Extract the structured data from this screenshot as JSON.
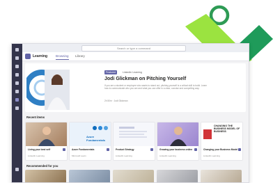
{
  "window": {
    "search_placeholder": "Search or type a command"
  },
  "app": {
    "name": "Learning",
    "tabs": [
      "Browsing",
      "Library"
    ]
  },
  "hero": {
    "badge": "Featured",
    "badge_sub": "LinkedIn Learning",
    "title": "Jodi Glickman on Pitching Yourself",
    "description": "If you are a student or employee who wants to stand out, pitching yourself is a critical skill to build. Learn how to communicate who you are and what you can offer in a clear, concise and compelling way.",
    "meta": "2h 50m  ·  Jodi Glickman"
  },
  "sections": {
    "recent": "Recent items",
    "recommended": "Recommended for you"
  },
  "cards": [
    {
      "title": "Living your best self",
      "meta": "LinkedIn Learning"
    },
    {
      "title": "Azure Fundamentals",
      "meta": "Microsoft Learn"
    },
    {
      "title": "Product Strategy",
      "meta": "LinkedIn Learning"
    },
    {
      "title": "Growing your business online",
      "meta": "LinkedIn Learning"
    },
    {
      "title": "Changing your Business Model",
      "meta": "LinkedIn Learning"
    }
  ],
  "card_overlays": {
    "azure": "Azure Fundamentals",
    "changing": "CHANGING THE BUSINESS MODEL OF BUSINESS"
  },
  "colors": {
    "brand": "#6264a7",
    "logo_light": "#9be340",
    "logo_dark": "#1f9b5a"
  }
}
